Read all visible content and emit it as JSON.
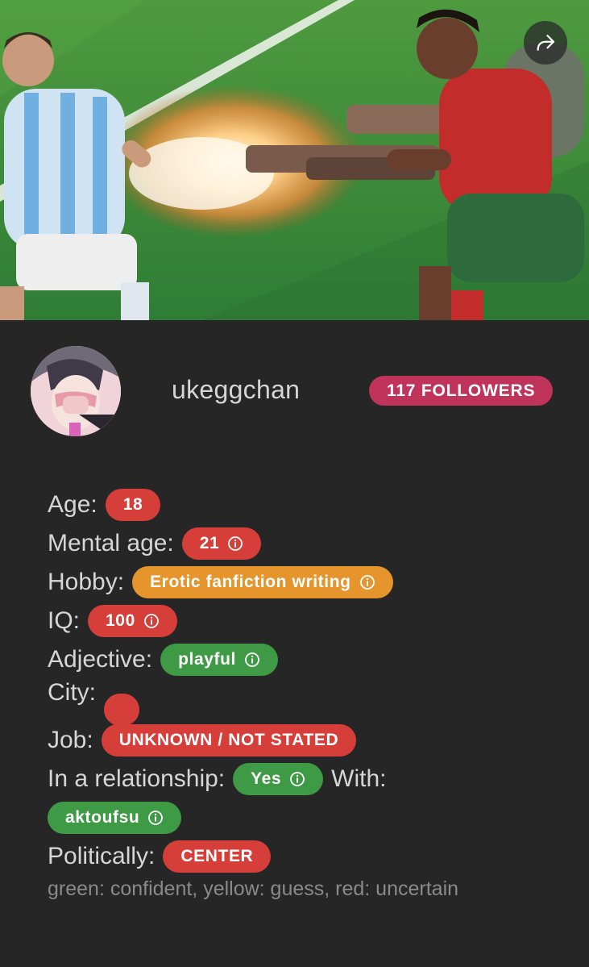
{
  "share": {
    "icon": "share-icon"
  },
  "profile": {
    "username": "ukeggchan",
    "followers_label": "117 FOLLOWERS"
  },
  "facts": {
    "age": {
      "label": "Age:",
      "value": "18",
      "color": "red"
    },
    "mental_age": {
      "label": "Mental age:",
      "value": "21",
      "color": "red"
    },
    "hobby": {
      "label": "Hobby:",
      "value": "Erotic fanfiction writing",
      "color": "yellow"
    },
    "iq": {
      "label": "IQ:",
      "value": "100",
      "color": "red"
    },
    "adjective": {
      "label": "Adjective:",
      "value": "playful",
      "color": "green"
    },
    "city": {
      "label": "City:",
      "value": "",
      "color": "red"
    },
    "job": {
      "label": "Job:",
      "value": "UNKNOWN / NOT STATED",
      "color": "red"
    },
    "relationship": {
      "label": "In a relationship:",
      "value": "Yes",
      "color": "green",
      "with_label": "With:"
    },
    "partner": {
      "value": "aktoufsu",
      "color": "green"
    },
    "politically": {
      "label": "Politically:",
      "value": "CENTER",
      "color": "red"
    }
  },
  "legend": "green: confident, yellow: guess, red: uncertain",
  "colors": {
    "red": "#d63e3a",
    "green": "#3e9a44",
    "yellow": "#e6942c",
    "followers": "#c0335b",
    "background": "#262626"
  }
}
